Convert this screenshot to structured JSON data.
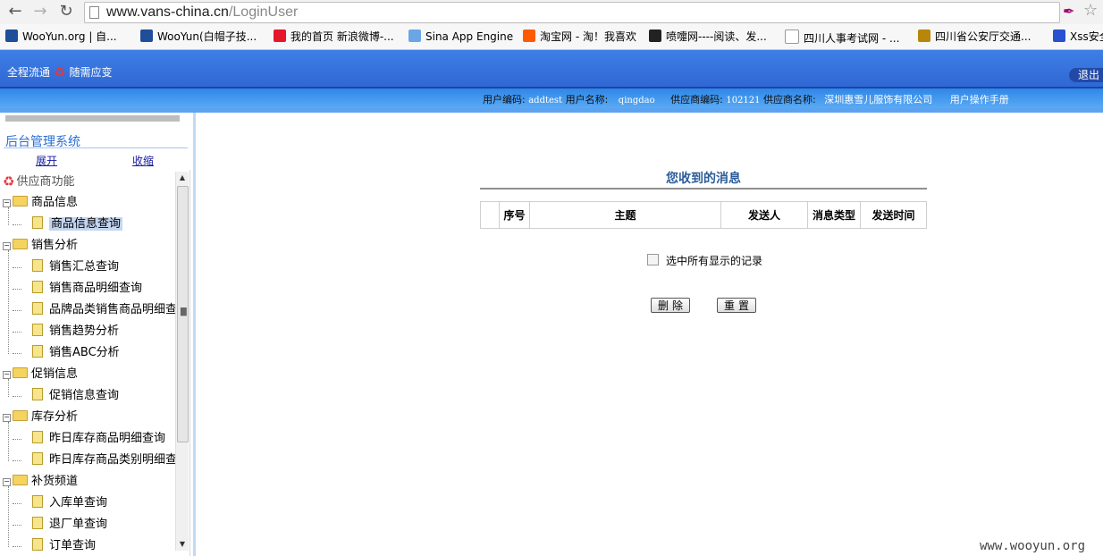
{
  "browser": {
    "url_host": "www.vans-china.cn",
    "url_path": "/LoginUser",
    "bookmarks": [
      {
        "label": "WooYun.org | 自...",
        "icon": "wooyun-icon",
        "color": "#1f4e9a"
      },
      {
        "label": "WooYun(白帽子技...",
        "icon": "wooyun-icon",
        "color": "#1f4e9a"
      },
      {
        "label": "我的首页 新浪微博-...",
        "icon": "weibo-icon",
        "color": "#e6162d"
      },
      {
        "label": "Sina App Engine",
        "icon": "cloud-icon",
        "color": "#6aa6e6"
      },
      {
        "label": "淘宝网 - 淘！我喜欢",
        "icon": "taobao-icon",
        "color": "#ff5a00"
      },
      {
        "label": "喷嚏网----阅读、发...",
        "icon": "penti-icon",
        "color": "#222222"
      },
      {
        "label": "四川人事考试网 - ...",
        "icon": "page-icon",
        "color": "#ffffff"
      },
      {
        "label": "四川省公安厅交通...",
        "icon": "police-icon",
        "color": "#b8860b"
      },
      {
        "label": "Xss安全",
        "icon": "paw-icon",
        "color": "#2850d0"
      }
    ]
  },
  "header": {
    "slogan_left": "全程流通",
    "slogan_right": "随需应变",
    "logout": "退出"
  },
  "info": {
    "user_code_label": "用户编码:",
    "user_code": "addtest",
    "user_name_label": "用户名称:",
    "user_name": "qingdao",
    "supplier_code_label": "供应商编码:",
    "supplier_code": "102121",
    "supplier_name_label": "供应商名称:",
    "supplier_name": "深圳惠雪儿服饰有限公司",
    "manual": "用户操作手册"
  },
  "sidebar": {
    "title": "后台管理系统",
    "expand": "展开",
    "collapse": "收缩",
    "root": "供应商功能",
    "groups": [
      {
        "label": "商品信息",
        "items": [
          "商品信息查询"
        ]
      },
      {
        "label": "销售分析",
        "items": [
          "销售汇总查询",
          "销售商品明细查询",
          "品牌品类销售商品明细查",
          "销售趋势分析",
          "销售ABC分析"
        ]
      },
      {
        "label": "促销信息",
        "items": [
          "促销信息查询"
        ]
      },
      {
        "label": "库存分析",
        "items": [
          "昨日库存商品明细查询",
          "昨日库存商品类别明细查"
        ]
      },
      {
        "label": "补货频道",
        "items": [
          "入库单查询",
          "退厂单查询",
          "订单查询"
        ]
      }
    ]
  },
  "main": {
    "title": "您收到的消息",
    "columns": [
      "",
      "序号",
      "主题",
      "发送人",
      "消息类型",
      "发送时间"
    ],
    "select_all": "选中所有显示的记录",
    "delete_button": "删除",
    "reset_button": "重置"
  },
  "watermark": "www.wooyun.org"
}
